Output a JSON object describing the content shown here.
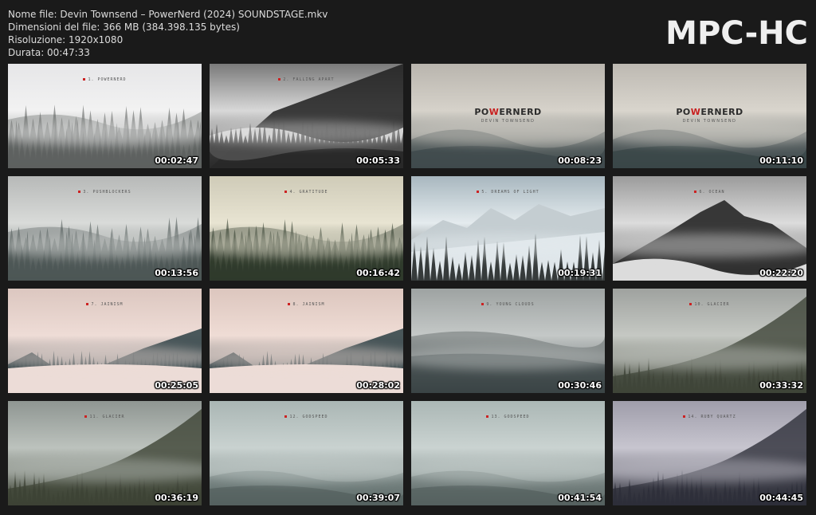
{
  "header": {
    "filename_label": "Nome file: Devin Townsend – PowerNerd (2024) SOUNDSTAGE.mkv",
    "filesize_label": "Dimensioni del file: 366 MB (384.398.135 bytes)",
    "resolution_label": "Risoluzione: 1920x1080",
    "duration_label": "Durata: 00:47:33"
  },
  "logo": "MPC-HC",
  "thumbnails": [
    {
      "time": "00:02:47",
      "caption": "1. POWERNERD",
      "sky": "#e6e6e8",
      "ground": "#5d605f",
      "mist": "#f2f2f2",
      "style": "forest"
    },
    {
      "time": "00:05:33",
      "caption": "2. FALLING APART",
      "sky": "#7a7a7a",
      "ground": "#2e2e2e",
      "mist": "#d8d8d8",
      "style": "bw"
    },
    {
      "time": "00:08:23",
      "caption": "",
      "sky": "#b9b5ae",
      "ground": "#3f4a4c",
      "mist": "#d6d2ca",
      "style": "brand",
      "brand_pre": "PO",
      "brand_w": "W",
      "brand_post": "ERNERD",
      "brand_sub": "DEVIN TOWNSEND"
    },
    {
      "time": "00:11:10",
      "caption": "",
      "sky": "#bdb9b2",
      "ground": "#3a4648",
      "mist": "#d9d5cd",
      "style": "brand",
      "brand_pre": "PO",
      "brand_w": "W",
      "brand_post": "ERNERD",
      "brand_sub": "DEVIN TOWNSEND"
    },
    {
      "time": "00:13:56",
      "caption": "3. PUSHBLOCKERS",
      "sky": "#b7b9b8",
      "ground": "#4d5655",
      "mist": "#d9dbd9",
      "style": "forest"
    },
    {
      "time": "00:16:42",
      "caption": "4. GRATITUDE",
      "sky": "#cfcbb8",
      "ground": "#2f3a2b",
      "mist": "#e8e4d2",
      "style": "forest"
    },
    {
      "time": "00:19:31",
      "caption": "5. DREAMS OF LIGHT",
      "sky": "#a8b7bf",
      "ground": "#2c3231",
      "mist": "#e4ebee",
      "style": "snow"
    },
    {
      "time": "00:22:20",
      "caption": "6. OCEAN",
      "sky": "#9b9b9b",
      "ground": "#3a3a3a",
      "mist": "#dcdcdc",
      "style": "peak"
    },
    {
      "time": "00:25:05",
      "caption": "7. JAINISM",
      "sky": "#dcc7c0",
      "ground": "#2d3f44",
      "mist": "#eedcd6",
      "style": "sunset"
    },
    {
      "time": "00:28:02",
      "caption": "8. JAINISM",
      "sky": "#dcc6be",
      "ground": "#2c3e43",
      "mist": "#efdcd5",
      "style": "sunset"
    },
    {
      "time": "00:30:46",
      "caption": "9. YOUNG CLOUDS",
      "sky": "#9ea3a2",
      "ground": "#3b4446",
      "mist": "#c4c8c7",
      "style": "fog"
    },
    {
      "time": "00:33:32",
      "caption": "10. GLACIER",
      "sky": "#9fa29f",
      "ground": "#3f4538",
      "mist": "#c5c8c3",
      "style": "slope"
    },
    {
      "time": "00:36:19",
      "caption": "11. GLACIER",
      "sky": "#8f9692",
      "ground": "#3d4335",
      "mist": "#bcc2bd",
      "style": "slope"
    },
    {
      "time": "00:39:07",
      "caption": "12. GODSPEED",
      "sky": "#aab6b4",
      "ground": "#5e6b69",
      "mist": "#c9d2d0",
      "style": "cloud"
    },
    {
      "time": "00:41:54",
      "caption": "13. GODSPEED",
      "sky": "#abb7b5",
      "ground": "#5f6c6a",
      "mist": "#cad3d1",
      "style": "cloud"
    },
    {
      "time": "00:44:45",
      "caption": "14. RUBY QUARTZ",
      "sky": "#9f9daa",
      "ground": "#2e2f3a",
      "mist": "#c7c5cf",
      "style": "slope"
    }
  ]
}
